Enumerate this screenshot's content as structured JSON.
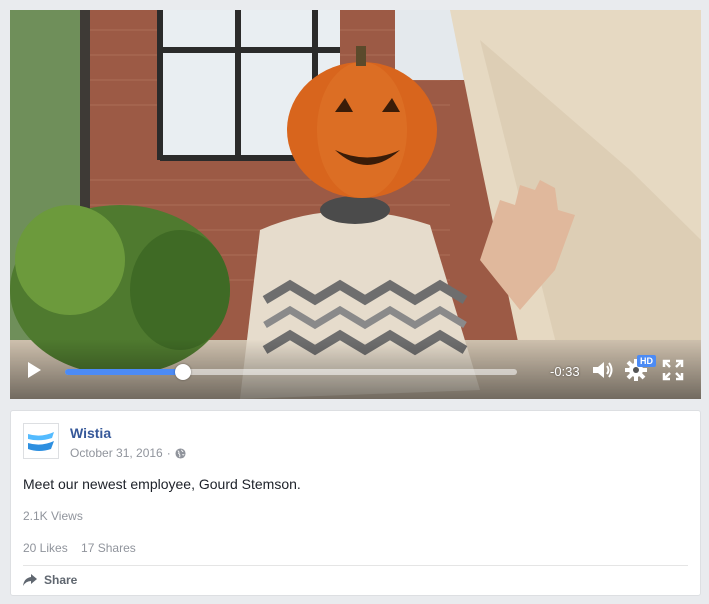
{
  "video": {
    "time_remaining": "-0:33",
    "progress": 0.26,
    "quality_badge": "HD"
  },
  "post": {
    "page_name": "Wistia",
    "date": "October 31, 2016",
    "separator": "·",
    "text": "Meet our newest employee, Gourd Stemson.",
    "views": "2.1K Views",
    "likes": "20 Likes",
    "shares": "17 Shares",
    "share_label": "Share"
  },
  "colors": {
    "link": "#365899",
    "accent": "#4c8bf5",
    "logo": "#54bbff"
  },
  "icons": [
    "play-icon",
    "volume-icon",
    "gear-icon",
    "fullscreen-icon",
    "globe-icon",
    "share-arrow-icon",
    "wistia-logo"
  ]
}
